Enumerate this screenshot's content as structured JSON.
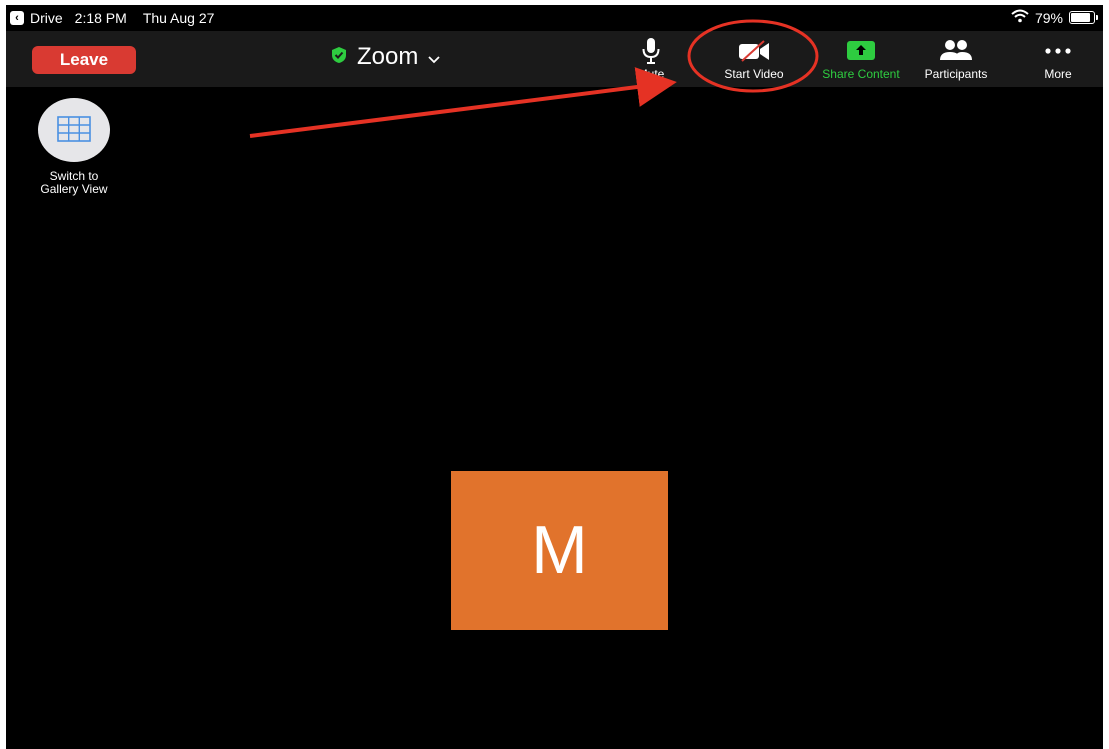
{
  "statusbar": {
    "back_app": "Drive",
    "time": "2:18 PM",
    "date": "Thu Aug 27",
    "battery": "79%",
    "battery_level": 0.79
  },
  "toolbar": {
    "leave_label": "Leave",
    "meeting_title": "Zoom",
    "mute_label": "Mute",
    "start_video_label": "Start Video",
    "share_content_label": "Share Content",
    "participants_label": "Participants",
    "more_label": "More"
  },
  "gallery": {
    "label_line1": "Switch to",
    "label_line2": "Gallery View"
  },
  "participant": {
    "initial": "M"
  },
  "colors": {
    "leave": "#d93a32",
    "share": "#2ecc40",
    "avatar": "#e1732c",
    "annotation": "#e53224",
    "toolbar": "#1a1a1a"
  },
  "icons": {
    "back": "chevron-left-icon",
    "wifi": "wifi-icon",
    "battery": "battery-icon",
    "shield": "shield-check-icon",
    "dropdown": "chevron-down-icon",
    "mic": "microphone-icon",
    "video": "video-off-icon",
    "share": "share-screen-icon",
    "participants": "participants-icon",
    "more": "more-dots-icon",
    "gallery": "grid-icon"
  }
}
